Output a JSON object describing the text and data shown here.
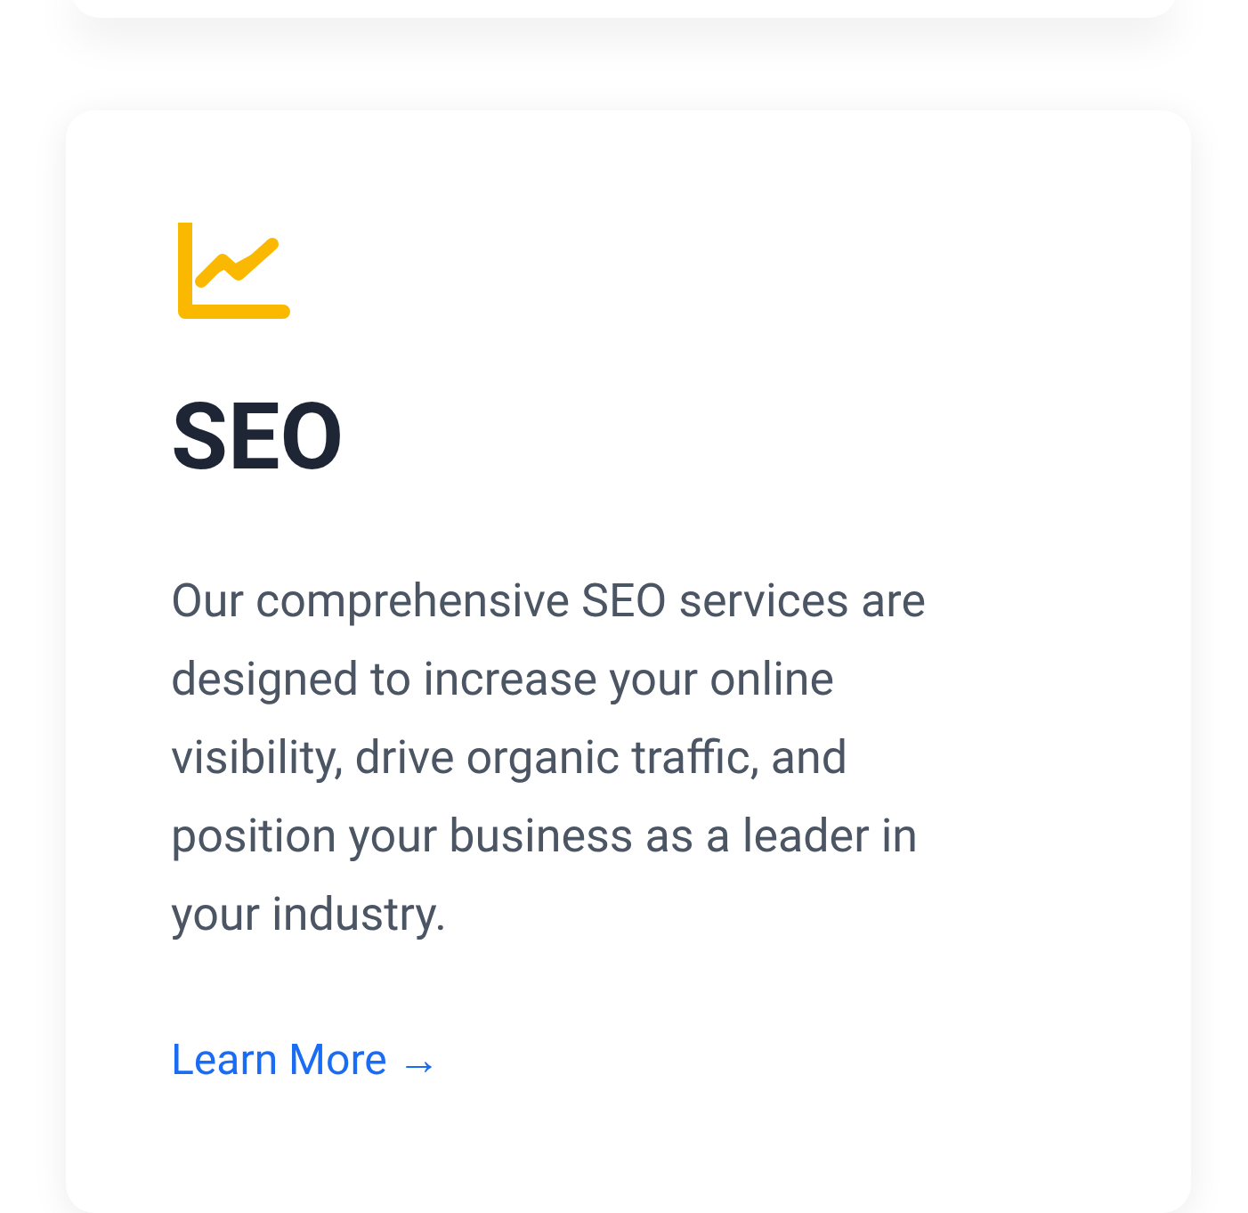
{
  "card": {
    "title": "SEO",
    "description": "Our comprehensive SEO services are designed to increase your online visibility, drive organic traffic, and position your business as a leader in your industry.",
    "link": "Learn More →"
  }
}
